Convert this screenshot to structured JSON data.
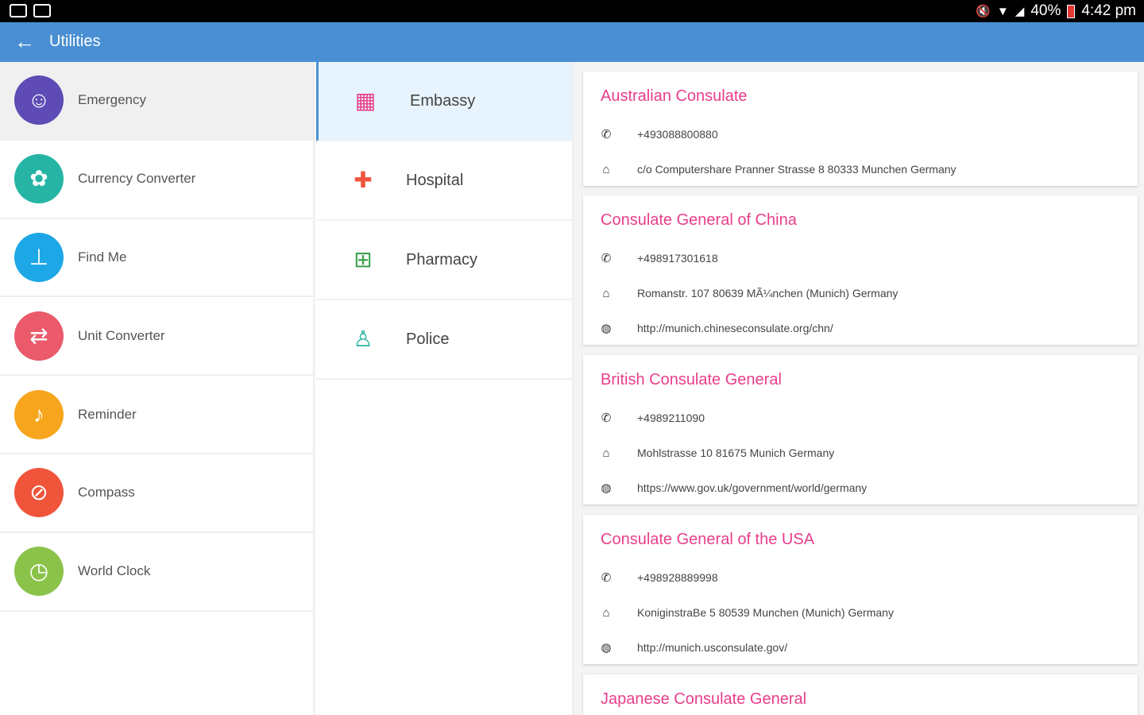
{
  "status_bar": {
    "battery": "40%",
    "time": "4:42 pm"
  },
  "app_bar": {
    "title": "Utilities"
  },
  "sidebar": {
    "items": [
      {
        "label": "Emergency",
        "icon": "emergency-icon",
        "color": "#5e4bb5"
      },
      {
        "label": "Currency Converter",
        "icon": "currency-icon",
        "color": "#26b5a5"
      },
      {
        "label": "Find Me",
        "icon": "pin-icon",
        "color": "#1ea7e6"
      },
      {
        "label": "Unit Converter",
        "icon": "swap-icon",
        "color": "#ea5a6b"
      },
      {
        "label": "Reminder",
        "icon": "bell-icon",
        "color": "#f7a51c"
      },
      {
        "label": "Compass",
        "icon": "compass-icon",
        "color": "#f0543b"
      },
      {
        "label": "World Clock",
        "icon": "clock-icon",
        "color": "#8bc34a"
      }
    ]
  },
  "categories": {
    "items": [
      {
        "label": "Embassy",
        "icon": "building-icon",
        "color": "#e83e8c"
      },
      {
        "label": "Hospital",
        "icon": "hospital-icon",
        "color": "#f0543b"
      },
      {
        "label": "Pharmacy",
        "icon": "pharmacy-icon",
        "color": "#3aa14f"
      },
      {
        "label": "Police",
        "icon": "police-icon",
        "color": "#26b5a5"
      }
    ]
  },
  "embassies": {
    "title_color": "#e83e8c",
    "cards": [
      {
        "title": "Australian Consulate",
        "phone": "+493088800880",
        "address": "c/o Computershare Pranner Strasse 8 80333 Munchen Germany"
      },
      {
        "title": "Consulate General of China",
        "phone": "+498917301618",
        "address": "Romanstr. 107 80639 MÃ¼nchen (Munich) Germany",
        "website": "http://munich.chineseconsulate.org/chn/"
      },
      {
        "title": "British Consulate General",
        "phone": "+4989211090",
        "address": "Mohlstrasse 10 81675 Munich Germany",
        "website": "https://www.gov.uk/government/world/germany"
      },
      {
        "title": "Consulate General of the USA",
        "phone": "+498928889998",
        "address": "KoniginstraBe 5 80539 Munchen (Munich) Germany",
        "website": "http://munich.usconsulate.gov/"
      },
      {
        "title": "Japanese Consulate General"
      }
    ]
  }
}
